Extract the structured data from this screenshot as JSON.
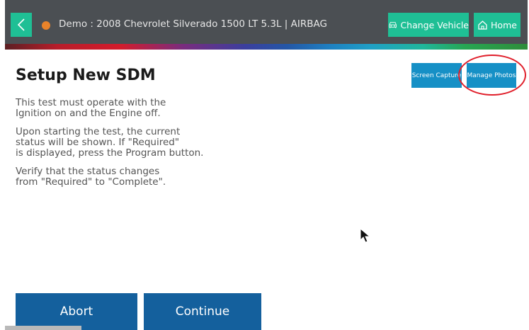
{
  "header": {
    "vehicle_title": "Demo : 2008 Chevrolet Silverado 1500 LT 5.3L | AIRBAG",
    "change_vehicle_label": "Change Vehicle",
    "home_label": "Home",
    "icons": {
      "back": "chevron-left-icon",
      "status": "status-dot-icon",
      "vehicle": "car-icon",
      "home": "home-icon"
    },
    "colors": {
      "background": "#4b4f53",
      "accent": "#1fbf95",
      "status_dot": "#e8832a"
    }
  },
  "main": {
    "title": "Setup New SDM",
    "instructions": [
      "This test must operate with the\nIgnition on and the Engine off.",
      "Upon starting the test, the current\nstatus will be shown. If \"Required\"\nis displayed, press the Program button.",
      "Verify that the status changes\nfrom \"Required\" to \"Complete\"."
    ]
  },
  "tools": {
    "screen_capture_label": "Screen Capture",
    "manage_photos_label": "Manage Photos",
    "highlight_color": "#e01e2a",
    "button_color": "#1690c6"
  },
  "footer": {
    "abort_label": "Abort",
    "continue_label": "Continue",
    "button_color": "#14609d"
  }
}
